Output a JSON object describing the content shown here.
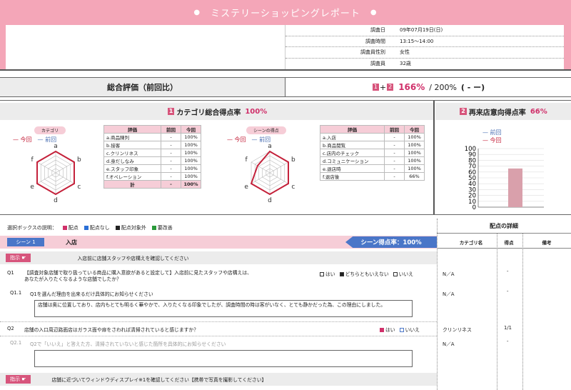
{
  "header": {
    "title": "ミステリーショッピングレポート",
    "bullet": "●"
  },
  "info": [
    {
      "key": "調査日",
      "value": "09年07月19日(日)"
    },
    {
      "key": "調査時間",
      "value": "13:15～14:00"
    },
    {
      "key": "調査員性別",
      "value": "女性"
    },
    {
      "key": "調査員",
      "value": "32歳"
    }
  ],
  "summary": {
    "label": "総合評価（前回比）",
    "badge1": "1",
    "plus": "+",
    "badge2": "2",
    "score": "166%",
    "total": "/ 200%",
    "diff": "( - ー)"
  },
  "category_section": {
    "badge": "1",
    "label": "カテゴリ総合得点率",
    "value": "100%"
  },
  "repeat_section": {
    "badge": "2",
    "label": "再来店意向得点率",
    "value": "66%"
  },
  "radar1": {
    "pill": "カテゴリ",
    "now": "今回",
    "prev": "前回",
    "axes": [
      "a",
      "b",
      "c",
      "d",
      "e",
      "f"
    ]
  },
  "radar2": {
    "pill": "シーンの得点",
    "now": "今回",
    "prev": "前回",
    "axes": [
      "a",
      "b",
      "c",
      "d",
      "e",
      "f"
    ]
  },
  "table1": {
    "headers": [
      "評価",
      "前回",
      "今回"
    ],
    "rows": [
      [
        "a.商品陳列",
        "-",
        "100%"
      ],
      [
        "b.接客",
        "-",
        "100%"
      ],
      [
        "c.クリンリネス",
        "-",
        "100%"
      ],
      [
        "d.身だしなみ",
        "-",
        "100%"
      ],
      [
        "e.スタッフ印象",
        "-",
        "100%"
      ],
      [
        "f.オペレーション",
        "-",
        "100%"
      ]
    ],
    "total": [
      "計",
      "-",
      "100%"
    ]
  },
  "table2": {
    "headers": [
      "評価",
      "前回",
      "今回"
    ],
    "rows": [
      [
        "a.入店",
        "-",
        "100%"
      ],
      [
        "b.商品閲覧",
        "-",
        "100%"
      ],
      [
        "c.店内のチェック",
        "-",
        "100%"
      ],
      [
        "d.コミュニケーション",
        "-",
        "100%"
      ],
      [
        "e.退店時",
        "-",
        "100%"
      ],
      [
        "f.退店後",
        "-",
        "66%"
      ]
    ]
  },
  "chart_data": {
    "type": "bar",
    "categories": [
      ""
    ],
    "series": [
      {
        "name": "前回",
        "values": [
          0
        ],
        "color": "#4a6fb3"
      },
      {
        "name": "今回",
        "values": [
          66
        ],
        "color": "#d9a0ab"
      }
    ],
    "ylim": [
      0,
      100
    ],
    "yticks": [
      "0",
      "10",
      "20",
      "30",
      "40",
      "50",
      "60",
      "70",
      "80",
      "90",
      "100"
    ]
  },
  "legend_box": {
    "label": "選択ボックスの説明：",
    "items": [
      {
        "label": "配点",
        "color": "#d0306a"
      },
      {
        "label": "配点なし",
        "color": "#2b6fd6"
      },
      {
        "label": "配点対象外",
        "color": "#222222"
      },
      {
        "label": "要改善",
        "color": "#2a9a3a"
      }
    ]
  },
  "details": {
    "title": "配点の詳細",
    "col1": "カテゴリ名",
    "col2": "得点",
    "col3": "備考"
  },
  "scene": {
    "tag": "シーン 1",
    "name": "入店",
    "score": "シーン得点率：100%"
  },
  "instructions": [
    {
      "label": "指示",
      "text": "入店前に店舗スタッフや店構えを確認してください"
    },
    {
      "label": "指示",
      "text": "店舗に近づいてウィンドウディスプレイ※1を確認してください【携帯で写真を撮影してください】"
    }
  ],
  "questions": [
    {
      "id": "Q1",
      "text": "【調査対象店舗で取り扱っている商品に購入意欲があると設定して】入店前に見たスタッフや店構えは、あなたが入りたくなるような店舗でしたか？",
      "options": [
        "はい",
        "どちらともいえない",
        "いいえ"
      ],
      "category": "N／A",
      "score": "-"
    },
    {
      "id": "Q1.1",
      "text": "Q1を選んだ理由を出来るだけ具体的にお知らせください",
      "answer": "店舗は奥に位置しており、店内もとても明るく華やかで、入りたくなる印象でしたが、調査時間の時は客がいなく、とても静かだった為、この理由にしました。",
      "category": "N／A",
      "score": "-"
    },
    {
      "id": "Q2",
      "text": "店舗の入口周辺路面店はガラス面や扉をさわれば清掃されていると感じますか？",
      "options": [
        "はい",
        "いいえ"
      ],
      "category": "クリンリネス",
      "score": "1/1"
    },
    {
      "id": "Q2.1",
      "text": "Q2で「いいえ」と答えた方、清掃されていないと感じた箇所を具体的にお知らせください",
      "answer": "",
      "category": "N／A",
      "score": "-"
    }
  ]
}
